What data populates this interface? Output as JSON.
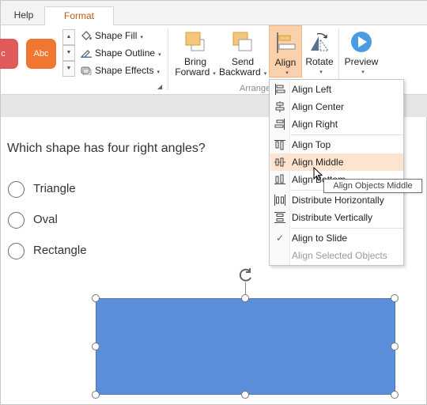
{
  "tabs": {
    "help": "Help",
    "format": "Format"
  },
  "gallery": {
    "item1": "c",
    "item2": "Abc",
    "scroll_up": "▲",
    "scroll_down": "▼",
    "scroll_more": "▼"
  },
  "shape_options": {
    "fill": "Shape Fill",
    "outline": "Shape Outline",
    "effects": "Shape Effects",
    "caret": "▾"
  },
  "arrange": {
    "bring_forward_line1": "Bring",
    "bring_forward_line2": "Forward",
    "send_backward_line1": "Send",
    "send_backward_line2": "Backward",
    "align": "Align",
    "rotate": "Rotate",
    "group_label": "Arrange",
    "caret": "▾"
  },
  "preview": {
    "label": "Preview",
    "caret": "▾"
  },
  "launcher": "◢",
  "question": "Which shape has four right angles?",
  "options": [
    "Triangle",
    "Oval",
    "Rectangle"
  ],
  "align_menu": {
    "left": "Align Left",
    "center": "Align Center",
    "right": "Align Right",
    "top": "Align Top",
    "middle": "Align Middle",
    "bottom": "Align Bottom",
    "distribute_h": "Distribute Horizontally",
    "distribute_v": "Distribute Vertically",
    "to_slide": "Align to Slide",
    "selected_objects": "Align Selected Objects",
    "check": "✓"
  },
  "tooltip": "Align Objects Middle",
  "colors": {
    "accent": "#c55a11",
    "hover": "#fce4cf",
    "shape_fill": "#5b8fd9",
    "gallery1": "#e15a5a",
    "gallery2": "#f07631"
  }
}
